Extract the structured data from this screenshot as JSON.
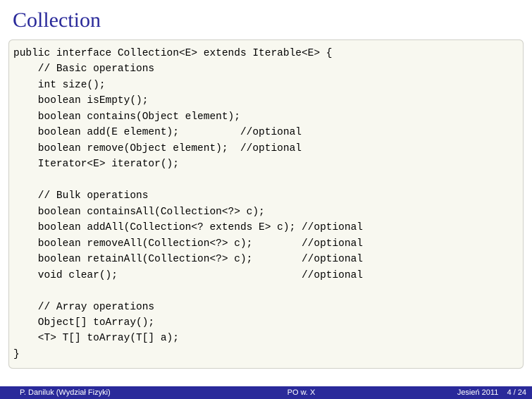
{
  "slide": {
    "title": "Collection"
  },
  "code": {
    "line01": "public interface Collection<E> extends Iterable<E> {",
    "line02": "    // Basic operations",
    "line03": "    int size();",
    "line04": "    boolean isEmpty();",
    "line05": "    boolean contains(Object element);",
    "line06": "    boolean add(E element);          //optional",
    "line07": "    boolean remove(Object element);  //optional",
    "line08": "    Iterator<E> iterator();",
    "line09": "",
    "line10": "    // Bulk operations",
    "line11": "    boolean containsAll(Collection<?> c);",
    "line12": "    boolean addAll(Collection<? extends E> c); //optional",
    "line13": "    boolean removeAll(Collection<?> c);        //optional",
    "line14": "    boolean retainAll(Collection<?> c);        //optional",
    "line15": "    void clear();                              //optional",
    "line16": "",
    "line17": "    // Array operations",
    "line18": "    Object[] toArray();",
    "line19": "    <T> T[] toArray(T[] a);",
    "line20": "}"
  },
  "footer": {
    "author": "P. Daniluk (Wydział Fizyki)",
    "course": "PO w. X",
    "term": "Jesień 2011",
    "page_current": "4",
    "page_sep": "/",
    "page_total": "24"
  }
}
